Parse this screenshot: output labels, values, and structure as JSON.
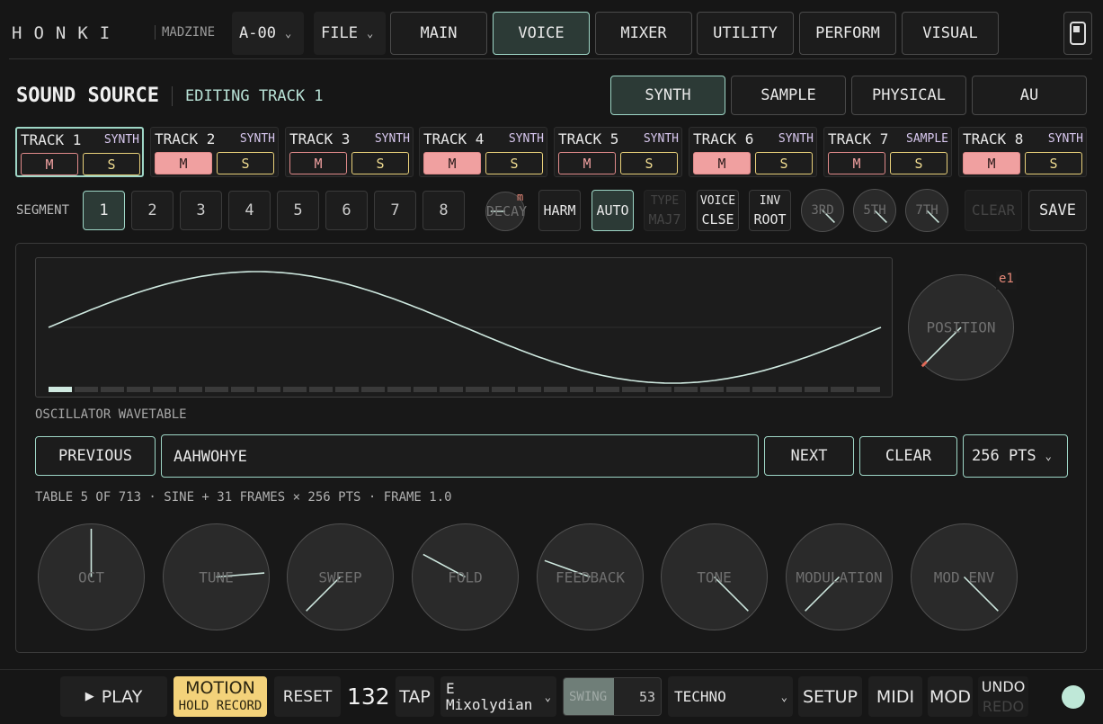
{
  "header": {
    "logo": "HONKI",
    "madzine": "MADZINE",
    "preset": "A-00",
    "file": "FILE",
    "tabs": [
      "MAIN",
      "VOICE",
      "MIXER",
      "UTILITY",
      "PERFORM",
      "VISUAL"
    ],
    "active_tab": "VOICE"
  },
  "section": {
    "title": "SOUND SOURCE",
    "subtitle": "EDITING TRACK 1",
    "source_tabs": [
      "SYNTH",
      "SAMPLE",
      "PHYSICAL",
      "AU"
    ],
    "active_source": "SYNTH"
  },
  "tracks": [
    {
      "name": "TRACK 1",
      "type": "SYNTH",
      "m": "M",
      "s": "S",
      "muted": false
    },
    {
      "name": "TRACK 2",
      "type": "SYNTH",
      "m": "M",
      "s": "S",
      "muted": true
    },
    {
      "name": "TRACK 3",
      "type": "SYNTH",
      "m": "M",
      "s": "S",
      "muted": false
    },
    {
      "name": "TRACK 4",
      "type": "SYNTH",
      "m": "M",
      "s": "S",
      "muted": true
    },
    {
      "name": "TRACK 5",
      "type": "SYNTH",
      "m": "M",
      "s": "S",
      "muted": false
    },
    {
      "name": "TRACK 6",
      "type": "SYNTH",
      "m": "M",
      "s": "S",
      "muted": true
    },
    {
      "name": "TRACK 7",
      "type": "SAMPLE",
      "m": "M",
      "s": "S",
      "muted": false
    },
    {
      "name": "TRACK 8",
      "type": "SYNTH",
      "m": "M",
      "s": "S",
      "muted": true
    }
  ],
  "segment": {
    "label": "SEGMENT",
    "items": [
      "1",
      "2",
      "3",
      "4",
      "5",
      "6",
      "7",
      "8"
    ],
    "active": "1"
  },
  "controls": {
    "decay": "DECAY",
    "decay_badge": "m",
    "harm": "HARM",
    "auto": "AUTO",
    "type_top": "TYPE",
    "type_bottom": "MAJ7",
    "voice_top": "VOICE",
    "voice_bottom": "CLSE",
    "inv_top": "INV",
    "inv_bottom": "ROOT",
    "third": "3RD",
    "fifth": "5TH",
    "seventh": "7TH",
    "clear": "CLEAR",
    "save": "SAVE"
  },
  "wavetable": {
    "label": "OSCILLATOR WAVETABLE",
    "position_label": "POSITION",
    "position_badge": "e1",
    "previous": "PREVIOUS",
    "name": "AAHWOHYE",
    "next": "NEXT",
    "clear": "CLEAR",
    "points": "256 PTS",
    "info": "TABLE 5 OF 713 · SINE + 31 FRAMES × 256 PTS · FRAME 1.0",
    "frame_count": 32,
    "active_frame": 1
  },
  "knobs": [
    "OCT",
    "TUNE",
    "SWEEP",
    "FOLD",
    "FEEDBACK",
    "TONE",
    "MODULATION",
    "MOD ENV"
  ],
  "transport": {
    "play": "PLAY",
    "motion": "MOTION",
    "motion_sub": "HOLD RECORD",
    "reset": "RESET",
    "tempo": "132",
    "tap": "TAP",
    "scale_root": "E",
    "scale_mode": "Mixolydian",
    "swing_label": "SWING",
    "swing_value": "53",
    "style": "TECHNO",
    "setup": "SETUP",
    "midi": "MIDI",
    "mod": "MOD",
    "undo": "UNDO",
    "redo": "REDO"
  },
  "colors": {
    "accent": "#9ed6c6",
    "mute_on": "#f0a0a0",
    "solo": "#f0dc90",
    "motion": "#f3d27a",
    "status": "#bfe8d8"
  }
}
